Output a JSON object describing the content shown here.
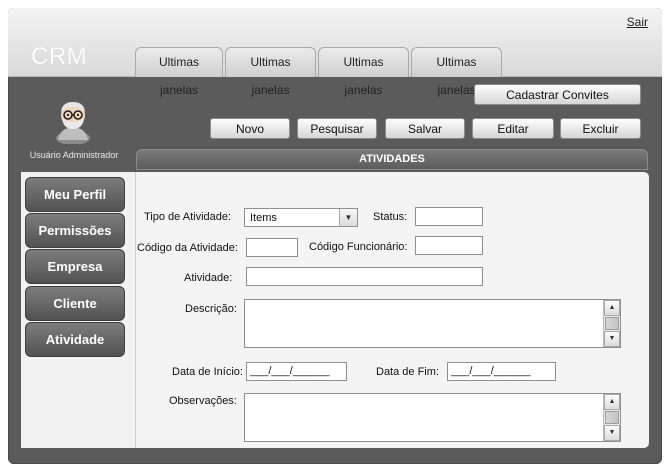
{
  "header": {
    "logo": "CRM",
    "logout_label": "Sair",
    "tabs": [
      "Ultimas janelas",
      "Ultimas janelas",
      "Ultimas janelas",
      "Ultimas janelas"
    ]
  },
  "user": {
    "label": "Usuário Administrador"
  },
  "toolbar": {
    "invite_label": "Cadastrar Convites",
    "new_label": "Novo",
    "search_label": "Pesquisar",
    "save_label": "Salvar",
    "edit_label": "Editar",
    "delete_label": "Excluir"
  },
  "section": {
    "title": "ATIVIDADES"
  },
  "sidebar": {
    "items": [
      {
        "label": "Meu Perfil"
      },
      {
        "label": "Permissões"
      },
      {
        "label": "Empresa"
      },
      {
        "label": "Cliente"
      },
      {
        "label": "Atividade"
      }
    ]
  },
  "form": {
    "activity_type_label": "Tipo de Atividade:",
    "activity_type_value": "Items",
    "status_label": "Status:",
    "status_value": "",
    "activity_code_label": "Código da Atividade:",
    "activity_code_value": "",
    "employee_code_label": "Código Funcionário:",
    "employee_code_value": "",
    "activity_label": "Atividade:",
    "activity_value": "",
    "description_label": "Descrição:",
    "description_value": "",
    "start_date_label": "Data de Início:",
    "start_date_value": "___/___/______",
    "end_date_label": "Data de Fim:",
    "end_date_value": "___/___/______",
    "notes_label": "Observações:",
    "notes_value": ""
  },
  "colors": {
    "frame": "#5b5b5b",
    "header": "#e6e6e6",
    "panel": "#f4f4f4",
    "sidebar_button": "#666666"
  }
}
